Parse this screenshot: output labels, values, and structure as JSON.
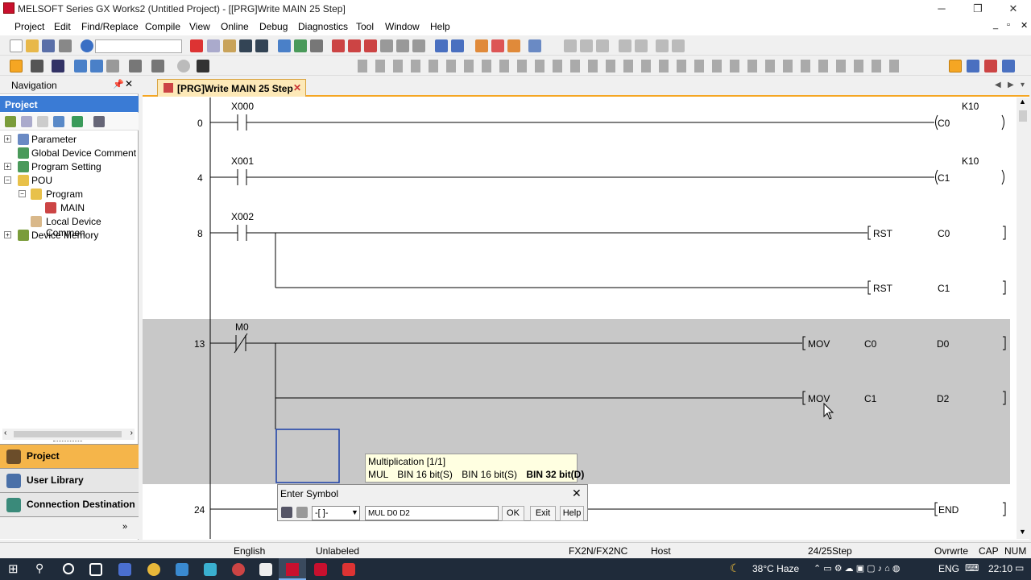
{
  "window": {
    "title": "MELSOFT Series GX Works2 (Untitled Project) - [[PRG]Write MAIN 25 Step]"
  },
  "menu": [
    "Project",
    "Edit",
    "Find/Replace",
    "Compile",
    "View",
    "Online",
    "Debug",
    "Diagnostics",
    "Tool",
    "Window",
    "Help"
  ],
  "nav": {
    "title": "Navigation",
    "section": "Project",
    "tree": [
      "Parameter",
      "Global Device Comment",
      "Program Setting",
      "POU",
      "Program",
      "MAIN",
      "Local Device Commen",
      "Device Memory"
    ],
    "bottom_tabs": [
      "Project",
      "User Library",
      "Connection Destination"
    ]
  },
  "editor": {
    "tab": "[PRG]Write MAIN 25 Step",
    "rungs": {
      "r0": {
        "step": "0",
        "contact": "X000",
        "coil": "C0",
        "k": "K10"
      },
      "r4": {
        "step": "4",
        "contact": "X001",
        "coil": "C1",
        "k": "K10"
      },
      "r8": {
        "step": "8",
        "contact": "X002",
        "i1": "RST",
        "a1": "C0",
        "i2": "RST",
        "a2": "C1"
      },
      "r13": {
        "step": "13",
        "contact": "M0",
        "i1": "MOV",
        "s1": "C0",
        "d1": "D0",
        "i2": "MOV",
        "s2": "C1",
        "d2": "D2"
      },
      "r24": {
        "step": "24",
        "end": "END"
      }
    }
  },
  "tooltip": {
    "title": "Multiplication [1/1]",
    "mnemonic": "MUL",
    "op1": "BIN 16 bit(S)",
    "op2": "BIN 16 bit(S)",
    "op3": "BIN 32 bit(D)"
  },
  "dialog": {
    "title": "Enter Symbol",
    "symbol": "-[ ]-",
    "value": "MUL D0 D2",
    "ok": "OK",
    "exit": "Exit",
    "help": "Help"
  },
  "statusbar": {
    "lang": "English",
    "label": "Unlabeled",
    "cpu": "FX2N/FX2NC",
    "host": "Host",
    "step": "24/25Step",
    "mode": "Ovrwrte",
    "caps": "CAP",
    "num": "NUM"
  },
  "taskbar": {
    "weather": "38°C Haze",
    "lang": "ENG",
    "time": "22:10"
  }
}
